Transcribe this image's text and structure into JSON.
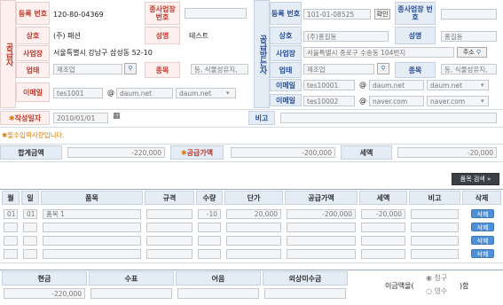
{
  "supplier": {
    "side_label": "공급자",
    "reg_no_label": "등록 번호",
    "reg_no": "120-80-04369",
    "branch_label": "종사업장 번호",
    "company_label": "상호",
    "company": "(주) 패션",
    "ceo_label": "성명",
    "ceo": "테스트",
    "address_label": "사업장",
    "address": "서울특별시 강남구 삼성동 52-10",
    "biz_type_label": "업태",
    "biz_type": "제조업",
    "biz_item_label": "종목",
    "biz_item": "등, 식물성유지,",
    "email_label": "이메일",
    "email_id": "tes1001",
    "email_domain": "daum.net",
    "email_select": "daum.net"
  },
  "receiver": {
    "side_label": "공급받는자",
    "reg_no_label": "등록 번호",
    "reg_no": "101-01-08525",
    "confirm_btn": "확인",
    "branch_label": "종사업장 번호",
    "company_label": "상호",
    "company": "(주)홍길동",
    "ceo_label": "성명",
    "ceo": "홍길동",
    "address_label": "사업장",
    "address": "서울특별시 종로구 수송동 104번지",
    "address_btn": "주소",
    "biz_type_label": "업태",
    "biz_type": "제조업",
    "biz_item_label": "종목",
    "biz_item": "등, 식물성유지,",
    "email_label": "이메일",
    "email1_id": "tes10001",
    "email1_domain": "daum.net",
    "email1_select": "daum.net",
    "email2_label": "이메일",
    "email2_id": "tes10002",
    "email2_domain": "naver.com",
    "email2_select": "naver.com"
  },
  "date_label": "작성일자",
  "date_value": "2010/01/01",
  "note_label": "비고",
  "required_note": "필수입력사항입니다.",
  "totals": {
    "total_label": "합계금액",
    "total": "-220,000",
    "supply_label": "공급가액",
    "supply": "-200,000",
    "tax_label": "세액",
    "tax": "-20,000"
  },
  "search_btn": "품목 검색 »",
  "items": {
    "headers": [
      "월",
      "일",
      "품목",
      "규격",
      "수량",
      "단가",
      "공급가액",
      "세액",
      "비고",
      "삭제"
    ],
    "rows": [
      {
        "month": "01",
        "day": "01",
        "name": "품목 1",
        "spec": "",
        "qty": "-10",
        "price": "20,000",
        "supply": "-200,000",
        "tax": "-20,000",
        "note": "",
        "del": "삭제"
      },
      {
        "month": "",
        "day": "",
        "name": "",
        "spec": "",
        "qty": "",
        "price": "",
        "supply": "",
        "tax": "",
        "note": "",
        "del": "삭제"
      },
      {
        "month": "",
        "day": "",
        "name": "",
        "spec": "",
        "qty": "",
        "price": "",
        "supply": "",
        "tax": "",
        "note": "",
        "del": "삭제"
      },
      {
        "month": "",
        "day": "",
        "name": "",
        "spec": "",
        "qty": "",
        "price": "",
        "supply": "",
        "tax": "",
        "note": "",
        "del": "삭제"
      }
    ]
  },
  "payment": {
    "headers": [
      "현금",
      "수표",
      "어음",
      "외상미수금"
    ],
    "cash": "-220,000",
    "prefix": "이금액을(",
    "opt_charge": "청구",
    "opt_receipt": "영수",
    "suffix": ")함"
  }
}
